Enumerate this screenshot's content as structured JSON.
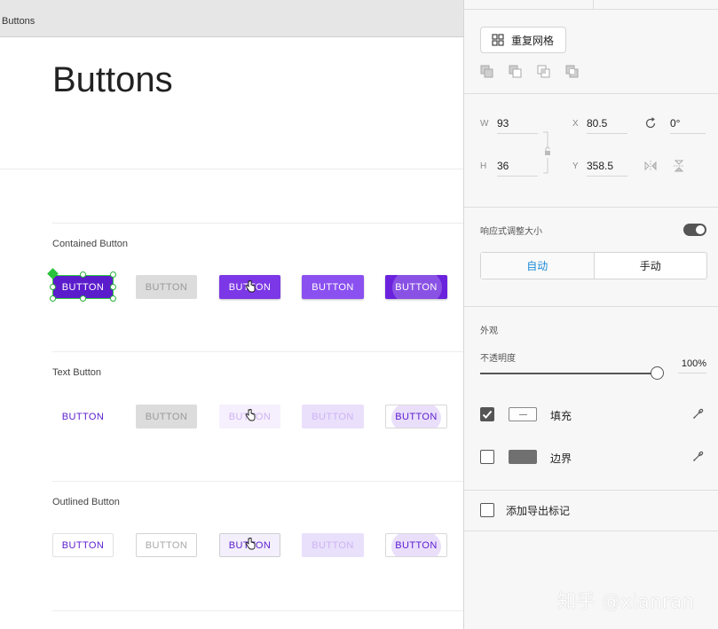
{
  "canvas": {
    "artboard_label": "Buttons",
    "title": "Buttons",
    "sections": [
      {
        "label": "Contained Button",
        "buttons": [
          "BUTTON",
          "BUTTON",
          "BUTTON",
          "BUTTON",
          "BUTTON"
        ]
      },
      {
        "label": "Text Button",
        "buttons": [
          "BUTTON",
          "BUTTON",
          "BUTTON",
          "BUTTON",
          "BUTTON"
        ]
      },
      {
        "label": "Outlined Button",
        "buttons": [
          "BUTTON",
          "BUTTON",
          "BUTTON",
          "BUTTON",
          "BUTTON"
        ]
      }
    ]
  },
  "panel": {
    "repeat_grid_label": "重复网格",
    "transform": {
      "w_label": "W",
      "w_value": "93",
      "h_label": "H",
      "h_value": "36",
      "x_label": "X",
      "x_value": "80.5",
      "y_label": "Y",
      "y_value": "358.5",
      "rotation_value": "0°"
    },
    "responsive": {
      "label": "响应式调整大小",
      "enabled": true,
      "options": [
        "自动",
        "手动"
      ],
      "selected": "自动"
    },
    "appearance": {
      "label": "外观",
      "opacity_label": "不透明度",
      "opacity_value": "100%",
      "opacity_fraction": 1.0,
      "fill_label": "填充",
      "fill_checked": true,
      "border_label": "边界",
      "border_checked": false
    },
    "export": {
      "label": "添加导出标记",
      "checked": false
    }
  },
  "watermark": "知乎 @xianran",
  "colors": {
    "primary": "#5b1ccc",
    "accent_blue": "#1b8ad6",
    "selection_green": "#2ecc40"
  }
}
